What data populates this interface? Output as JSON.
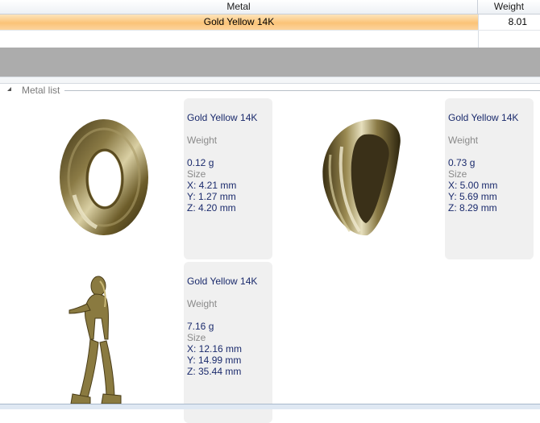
{
  "grid": {
    "columns": [
      "Metal",
      "Weight"
    ],
    "rows": [
      {
        "metal": "Gold Yellow 14K",
        "weight": "8.01"
      }
    ]
  },
  "metal_list": {
    "label": "Metal list",
    "items": [
      {
        "name": "Gold Yellow 14K",
        "weight_label": "Weight",
        "weight": "0.12 g",
        "size_label": "Size",
        "x": "X: 4.21 mm",
        "y": "Y: 1.27 mm",
        "z": "Z: 4.20 mm",
        "icon": "ring-donut-icon"
      },
      {
        "name": "Gold Yellow 14K",
        "weight_label": "Weight",
        "weight": "0.73 g",
        "size_label": "Size",
        "x": "X: 5.00 mm",
        "y": "Y: 5.69 mm",
        "z": "Z: 8.29 mm",
        "icon": "bail-loop-icon"
      },
      {
        "name": "Gold Yellow 14K",
        "weight_label": "Weight",
        "weight": "7.16 g",
        "size_label": "Size",
        "x": "X: 12.16 mm",
        "y": "Y: 14.99 mm",
        "z": "Z: 35.44 mm",
        "icon": "figurine-icon"
      }
    ]
  }
}
